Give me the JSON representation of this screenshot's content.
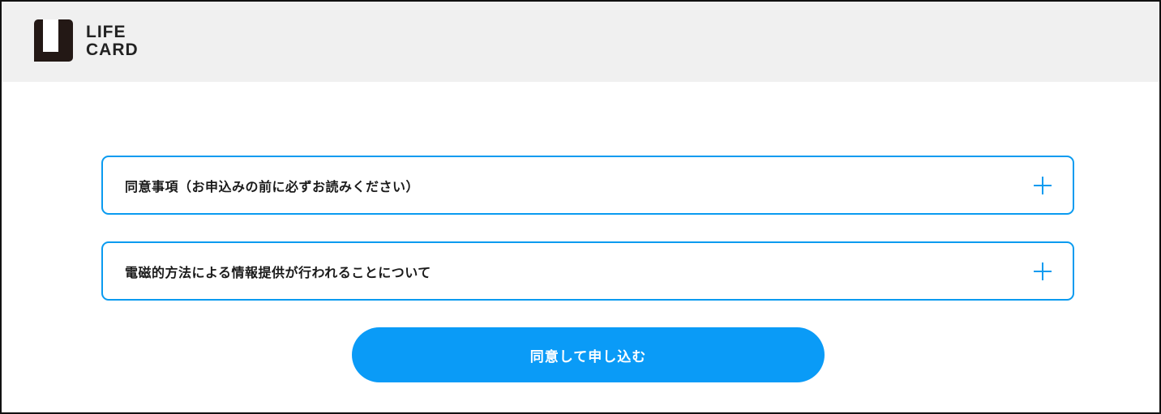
{
  "header": {
    "logo": {
      "line1": "LIFE",
      "line2": "CARD",
      "icon": "life-card-logo-mark"
    }
  },
  "main": {
    "accordions": [
      {
        "title": "同意事項（お申込みの前に必ずお読みください）",
        "icon": "plus-icon"
      },
      {
        "title": "電磁的方法による情報提供が行われることについて",
        "icon": "plus-icon"
      }
    ],
    "submit_label": "同意して申し込む"
  },
  "colors": {
    "accent": "#0a9bf0",
    "button": "#0a9bf7",
    "header_bg": "#f0f0f0",
    "text": "#1a1a1a"
  }
}
